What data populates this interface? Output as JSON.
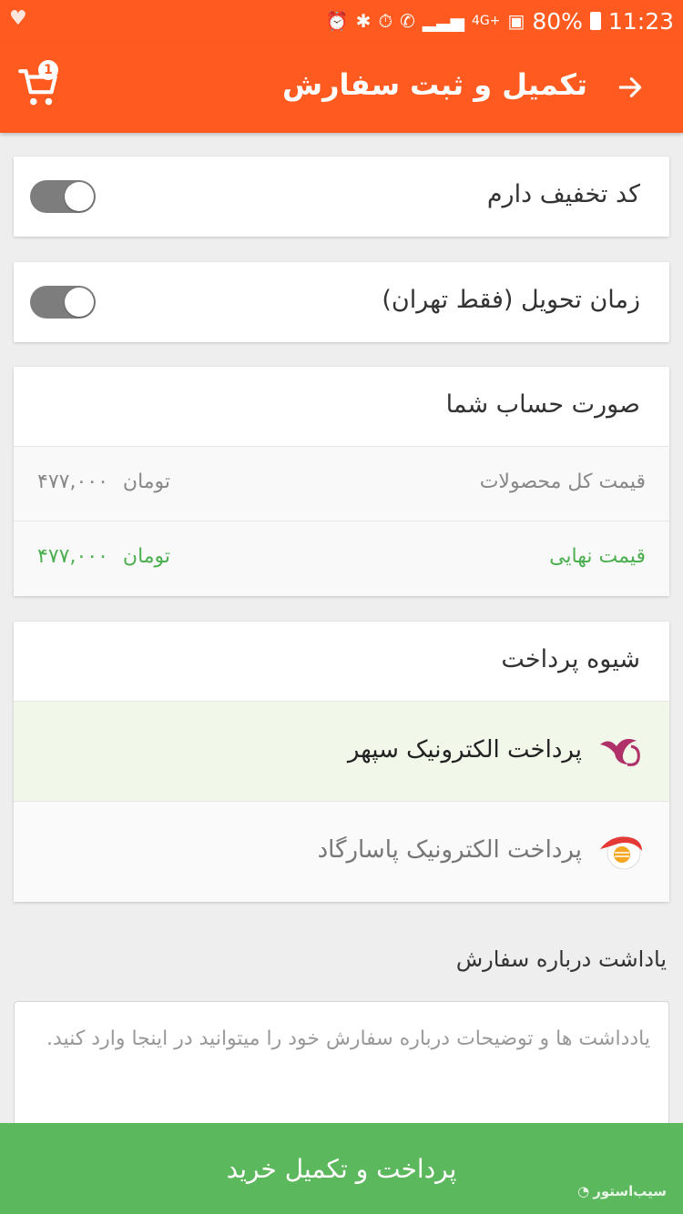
{
  "status_bar": {
    "battery": "80%",
    "time": "11:23",
    "network": "4G+",
    "icons": [
      "heart-rate-icon",
      "alarm-icon",
      "bluetooth-icon",
      "clock-icon",
      "call-icon",
      "signal-icon",
      "battery-icon"
    ]
  },
  "app_bar": {
    "title": "تکمیل و ثبت سفارش",
    "cart_count": "1",
    "color": "#ff5a1f"
  },
  "toggles": {
    "discount": {
      "label": "کد تخفیف دارم",
      "on": false
    },
    "delivery_time": {
      "label": "زمان تحویل (فقط تهران)",
      "on": false
    }
  },
  "invoice": {
    "title": "صورت حساب شما",
    "total_label": "قیمت کل محصولات",
    "total_amount": "۴۷۷,۰۰۰",
    "total_currency": "تومان",
    "final_label": "قیمت نهایی",
    "final_amount": "۴۷۷,۰۰۰",
    "final_currency": "تومان",
    "final_color": "#4caf50"
  },
  "payment": {
    "title": "شیوه پرداخت",
    "methods": [
      {
        "label": "پرداخت الکترونیک سپهر",
        "icon": "sepehr-logo-icon",
        "selected": true
      },
      {
        "label": "پرداخت الکترونیک پاسارگاد",
        "icon": "pasargad-logo-icon",
        "selected": false
      }
    ]
  },
  "note": {
    "title": "یاداشت درباره سفارش",
    "placeholder": "یادداشت ها و توضیحات درباره سفارش خود را میتوانید در اینجا وارد کنید."
  },
  "submit": {
    "label": "پرداخت و تکمیل خرید",
    "color": "#5cb85c"
  },
  "watermark": "سیب‌استور"
}
